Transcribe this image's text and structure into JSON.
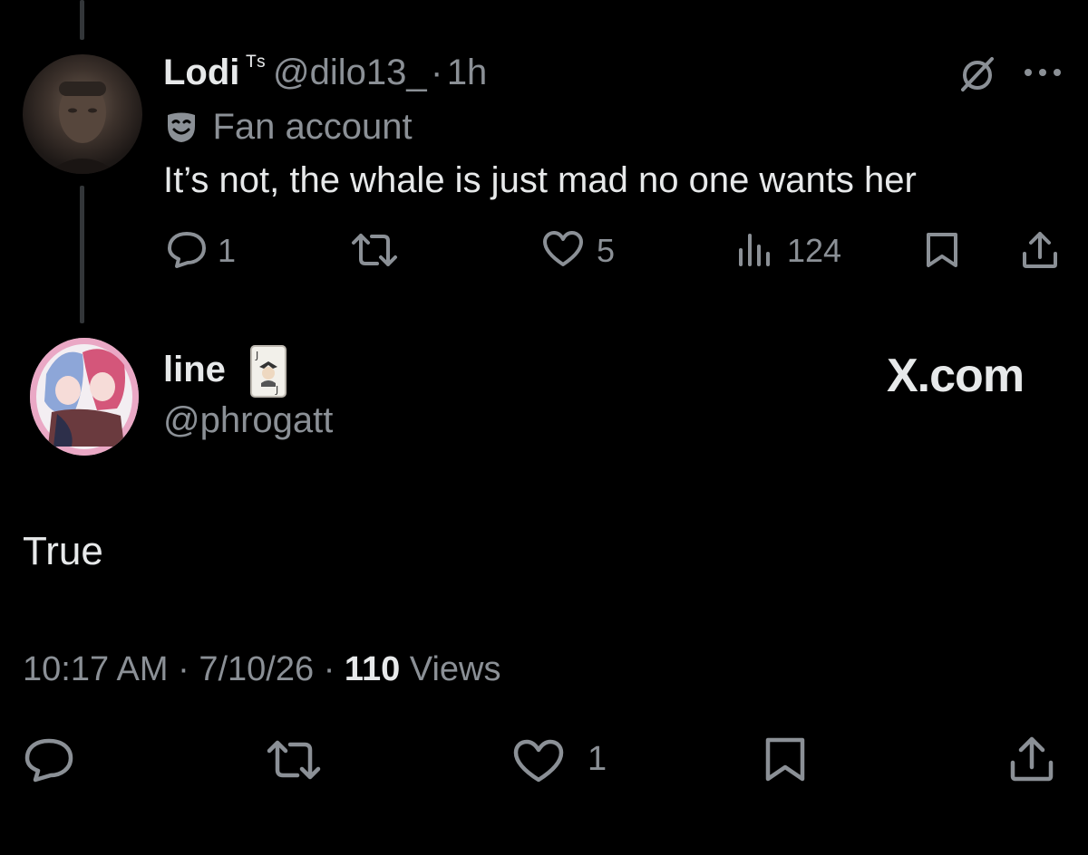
{
  "reply": {
    "display_name": "Lodi",
    "name_suffix": "ᵀˢ",
    "handle": "@dilo13_",
    "separator": "·",
    "time": "1h",
    "label": "Fan account",
    "text": "It’s not, the whale is just mad no one wants her",
    "actions": {
      "replies": "1",
      "likes": "5",
      "views": "124"
    }
  },
  "main": {
    "display_name": "line",
    "handle": "@phrogatt",
    "watermark": "X.com",
    "text": "True",
    "time": "10:17 AM",
    "sep1": "·",
    "date": "7/10/26",
    "sep2": "·",
    "views_count": "110",
    "views_label": "Views",
    "actions": {
      "likes": "1"
    }
  },
  "icons": {
    "reply": "reply-icon",
    "retweet": "retweet-icon",
    "like": "heart-icon",
    "views": "views-icon",
    "bookmark": "bookmark-icon",
    "share": "share-icon",
    "grok": "grok-icon",
    "more": "more-icon",
    "theater": "theater-mask-icon",
    "joker": "joker-card-icon"
  }
}
